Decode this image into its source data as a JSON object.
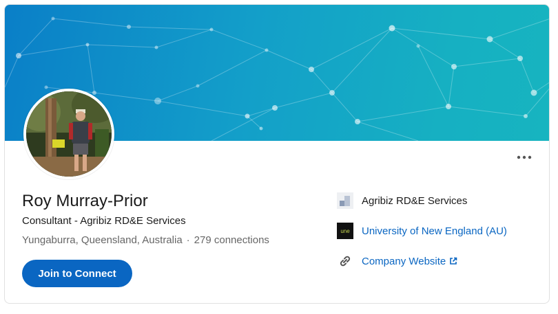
{
  "profile": {
    "name": "Roy Murray-Prior",
    "headline": "Consultant - Agribiz RD&E Services",
    "location": "Yungaburra, Queensland, Australia",
    "separator": "·",
    "connections": "279 connections",
    "join_label": "Join to Connect"
  },
  "side": {
    "company": "Agribiz RD&E Services",
    "university": "University of New England (AU)",
    "website": "Company Website",
    "university_logo_text": "une"
  },
  "icons": {
    "more": "more-horizontal-icon",
    "link": "link-icon",
    "external": "external-link-icon"
  },
  "colors": {
    "brand": "#0a66c2",
    "banner_start": "#0a7fc8",
    "banner_end": "#17b4c0"
  }
}
